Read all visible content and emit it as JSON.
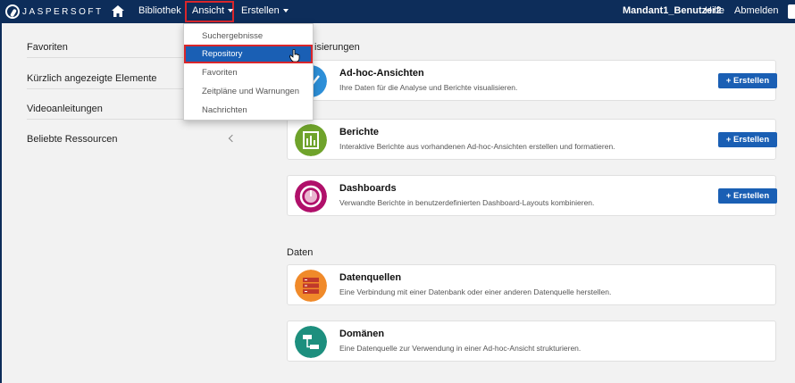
{
  "topbar": {
    "logo_text": "JASPERSOFT",
    "home_icon": "home-icon",
    "library": "Bibliothek",
    "view": "Ansicht",
    "create": "Erstellen",
    "user": "Mandant1_Benutzer2",
    "help": "Hilfe",
    "logout": "Abmelden"
  },
  "sidebar": {
    "items": [
      {
        "label": "Favoriten"
      },
      {
        "label": "Kürzlich angezeigte Elemente"
      },
      {
        "label": "Videoanleitungen"
      },
      {
        "label": "Beliebte Ressourcen"
      }
    ]
  },
  "dropdown": {
    "items": [
      {
        "label": "Suchergebnisse"
      },
      {
        "label": "Repository",
        "selected": true
      },
      {
        "label": "Favoriten"
      },
      {
        "label": "Zeitpläne und Warnungen"
      },
      {
        "label": "Nachrichten"
      }
    ]
  },
  "sections": {
    "visualize_partial": "isierungen",
    "data": "Daten"
  },
  "cards": [
    {
      "title": "Ad-hoc-Ansichten",
      "desc": "Ihre Daten für die Analyse und Berichte visualisieren.",
      "button": "+ Erstellen",
      "icon": "chart-icon",
      "color": "#2d8fd8"
    },
    {
      "title": "Berichte",
      "desc": "Interaktive Berichte aus vorhandenen Ad-hoc-Ansichten erstellen und formatieren.",
      "button": "+ Erstellen",
      "icon": "report-icon",
      "color": "#6fa32b"
    },
    {
      "title": "Dashboards",
      "desc": "Verwandte Berichte in benutzerdefinierten Dashboard-Layouts kombinieren.",
      "button": "+ Erstellen",
      "icon": "gauge-icon",
      "color": "#b0106a"
    },
    {
      "title": "Datenquellen",
      "desc": "Eine Verbindung mit einer Datenbank oder einer anderen Datenquelle herstellen.",
      "icon": "database-icon",
      "color": "#f08a2a"
    },
    {
      "title": "Domänen",
      "desc": "Eine Datenquelle zur Verwendung in einer Ad-hoc-Ansicht strukturieren.",
      "icon": "domain-icon",
      "color": "#1d8f7e"
    }
  ]
}
